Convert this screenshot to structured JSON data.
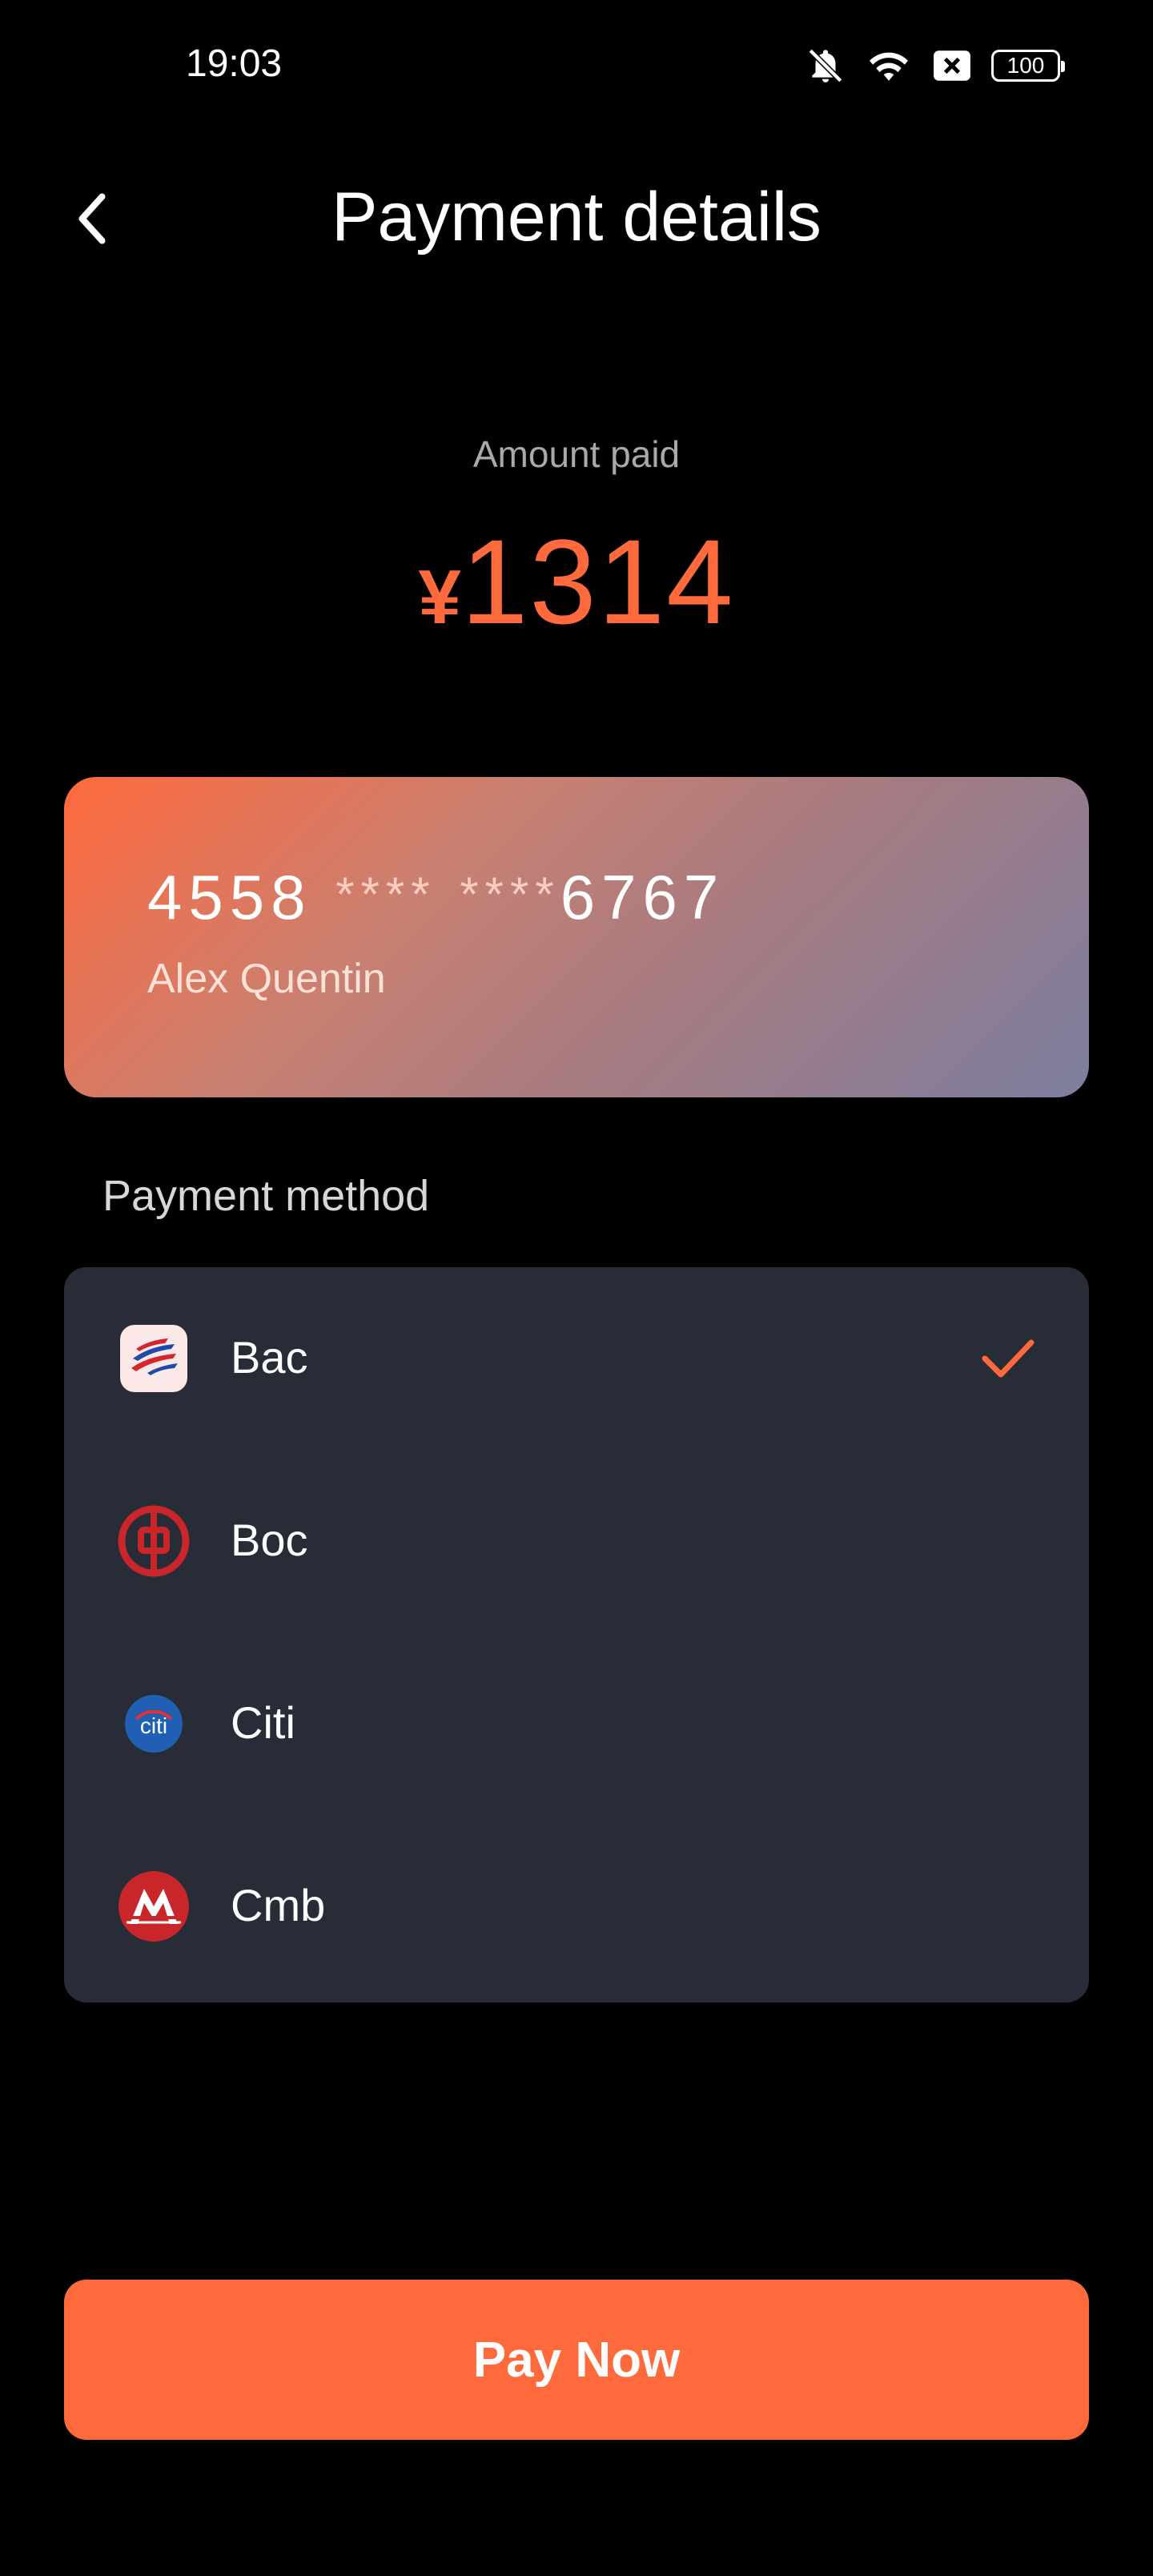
{
  "status_bar": {
    "time": "19:03",
    "battery": "100",
    "icons": [
      "bell-off-icon",
      "wifi-icon",
      "sim-blocked-icon",
      "battery-icon"
    ]
  },
  "header": {
    "title": "Payment details",
    "back_icon": "chevron-left-icon"
  },
  "amount": {
    "label": "Amount paid",
    "currency": "¥",
    "value": "1314"
  },
  "card": {
    "number_first": "4558",
    "number_mask_1": "****",
    "number_mask_2": "****",
    "number_last": "6767",
    "holder": "Alex Quentin"
  },
  "payment_method": {
    "label": "Payment method",
    "selected": "Bac",
    "items": [
      {
        "name": "Bac",
        "icon": "bac-bank-logo-icon",
        "selected": true
      },
      {
        "name": "Boc",
        "icon": "boc-bank-logo-icon",
        "selected": false
      },
      {
        "name": "Citi",
        "icon": "citi-bank-logo-icon",
        "logo_text": "citi",
        "selected": false
      },
      {
        "name": "Cmb",
        "icon": "cmb-bank-logo-icon",
        "selected": false
      }
    ]
  },
  "actions": {
    "pay_label": "Pay Now"
  },
  "colors": {
    "accent": "#ff6a3d",
    "list_background": "#272c37",
    "background": "#000000"
  }
}
